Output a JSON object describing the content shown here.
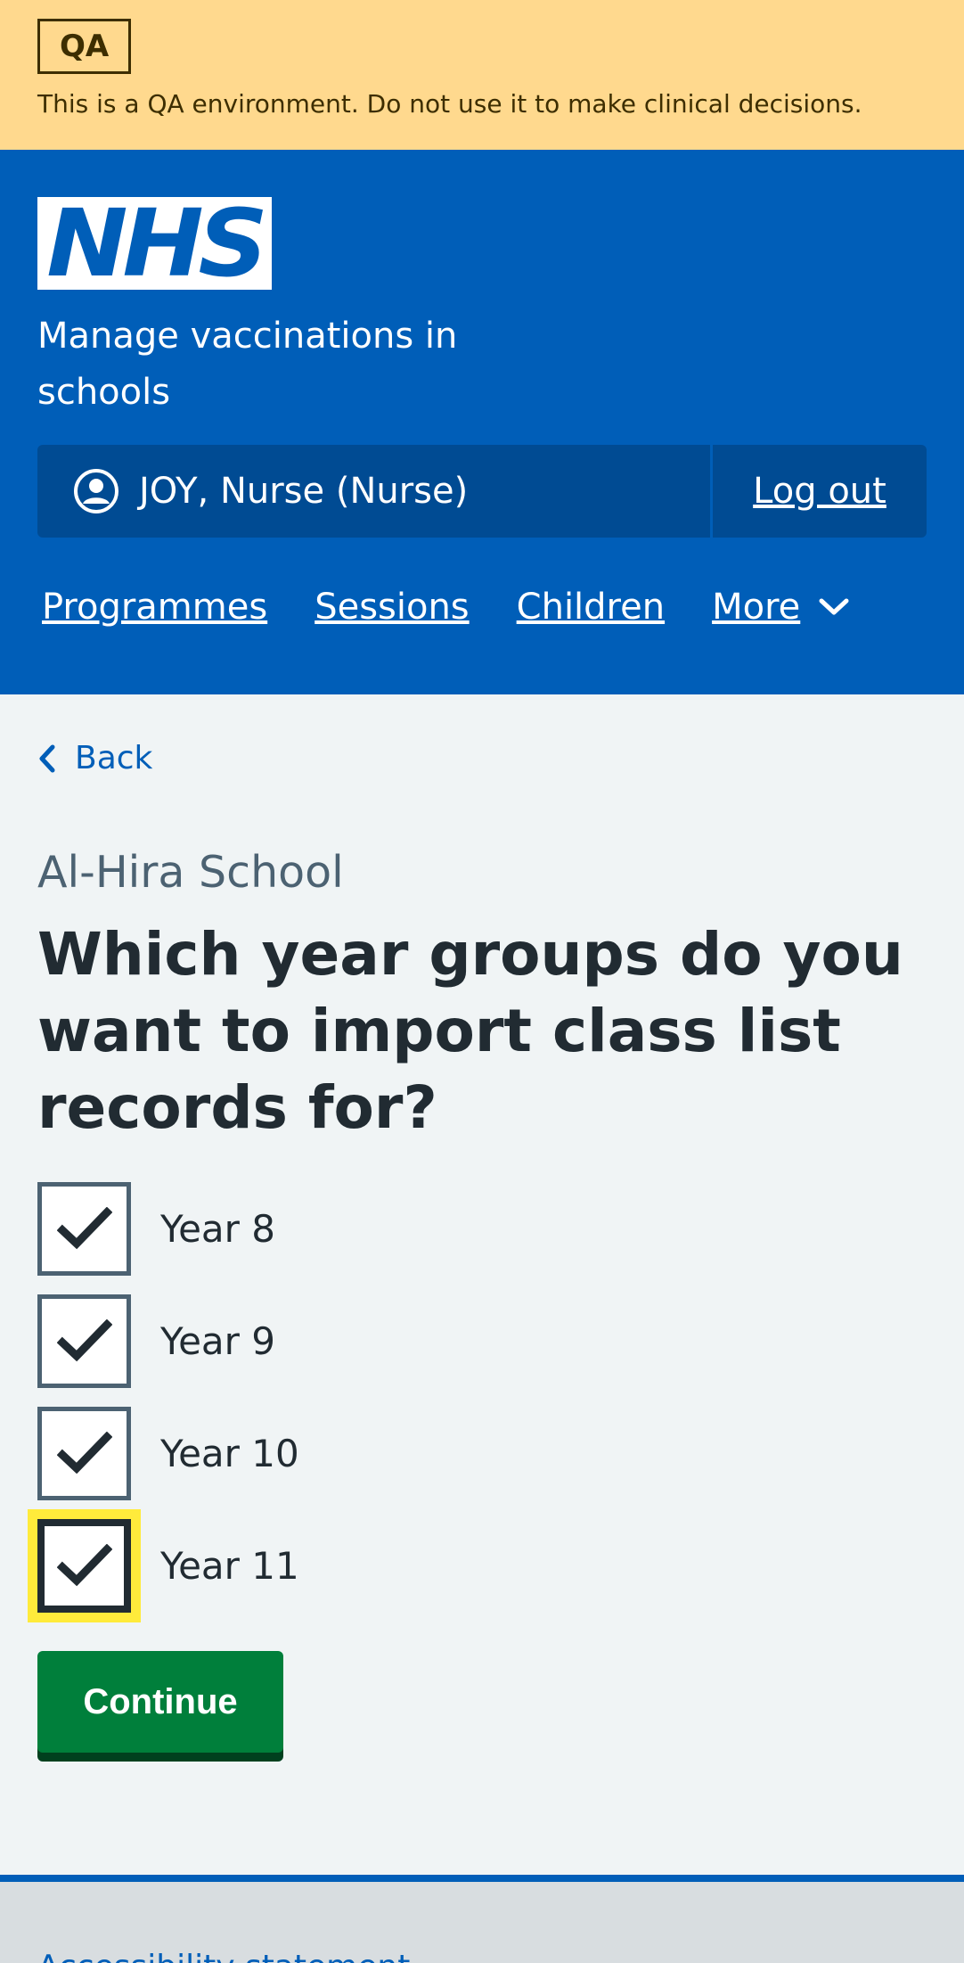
{
  "qa_banner": {
    "tag": "QA",
    "message": "This is a QA environment. Do not use it to make clinical decisions."
  },
  "header": {
    "logo_text": "NHS",
    "service_name": "Manage vaccinations in schools",
    "account": {
      "user_name": "JOY, Nurse (Nurse)",
      "logout_label": "Log out"
    },
    "nav": [
      {
        "label": "Programmes"
      },
      {
        "label": "Sessions"
      },
      {
        "label": "Children"
      },
      {
        "label": "More"
      }
    ]
  },
  "main": {
    "back_label": "Back",
    "caption": "Al-Hira School",
    "heading": "Which year groups do you want to import class list records for?",
    "year_groups": [
      {
        "label": "Year 8",
        "checked": true
      },
      {
        "label": "Year 9",
        "checked": true
      },
      {
        "label": "Year 10",
        "checked": true
      },
      {
        "label": "Year 11",
        "checked": true
      }
    ],
    "continue_label": "Continue"
  },
  "footer": {
    "link": "Accessibility statement"
  },
  "colors": {
    "nhs_blue": "#005eb8",
    "qa_banner": "#ffd98e",
    "continue_green": "#007f3b",
    "focus_yellow": "#ffeb3b"
  }
}
